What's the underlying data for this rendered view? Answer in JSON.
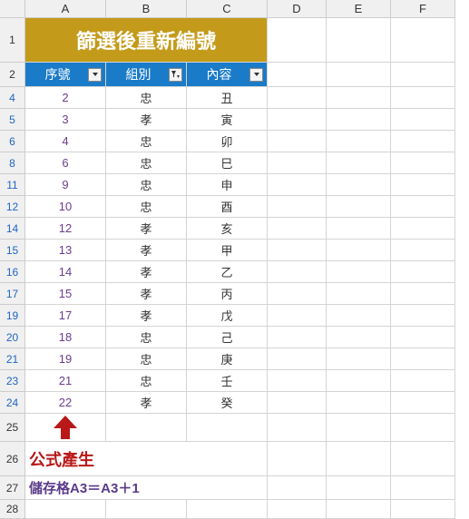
{
  "columns": [
    "A",
    "B",
    "C",
    "D",
    "E",
    "F"
  ],
  "title": "篩選後重新編號",
  "headers": {
    "seq": "序號",
    "group": "組別",
    "content": "內容"
  },
  "rows": [
    {
      "r": "4",
      "seq": "2",
      "group": "忠",
      "content": "丑"
    },
    {
      "r": "5",
      "seq": "3",
      "group": "孝",
      "content": "寅"
    },
    {
      "r": "6",
      "seq": "4",
      "group": "忠",
      "content": "卯"
    },
    {
      "r": "8",
      "seq": "6",
      "group": "忠",
      "content": "巳"
    },
    {
      "r": "11",
      "seq": "9",
      "group": "忠",
      "content": "申"
    },
    {
      "r": "12",
      "seq": "10",
      "group": "忠",
      "content": "酉"
    },
    {
      "r": "14",
      "seq": "12",
      "group": "孝",
      "content": "亥"
    },
    {
      "r": "15",
      "seq": "13",
      "group": "孝",
      "content": "甲"
    },
    {
      "r": "16",
      "seq": "14",
      "group": "孝",
      "content": "乙"
    },
    {
      "r": "17",
      "seq": "15",
      "group": "孝",
      "content": "丙"
    },
    {
      "r": "19",
      "seq": "17",
      "group": "孝",
      "content": "戊"
    },
    {
      "r": "20",
      "seq": "18",
      "group": "忠",
      "content": "己"
    },
    {
      "r": "21",
      "seq": "19",
      "group": "忠",
      "content": "庚"
    },
    {
      "r": "23",
      "seq": "21",
      "group": "忠",
      "content": "壬"
    },
    {
      "r": "24",
      "seq": "22",
      "group": "孝",
      "content": "癸"
    }
  ],
  "arrow": "⬆",
  "annot1": "公式產生",
  "annot2": "儲存格A3＝A3＋1",
  "emptyRows": [
    "25",
    "26",
    "27",
    "28"
  ],
  "row1": "1",
  "row2": "2"
}
